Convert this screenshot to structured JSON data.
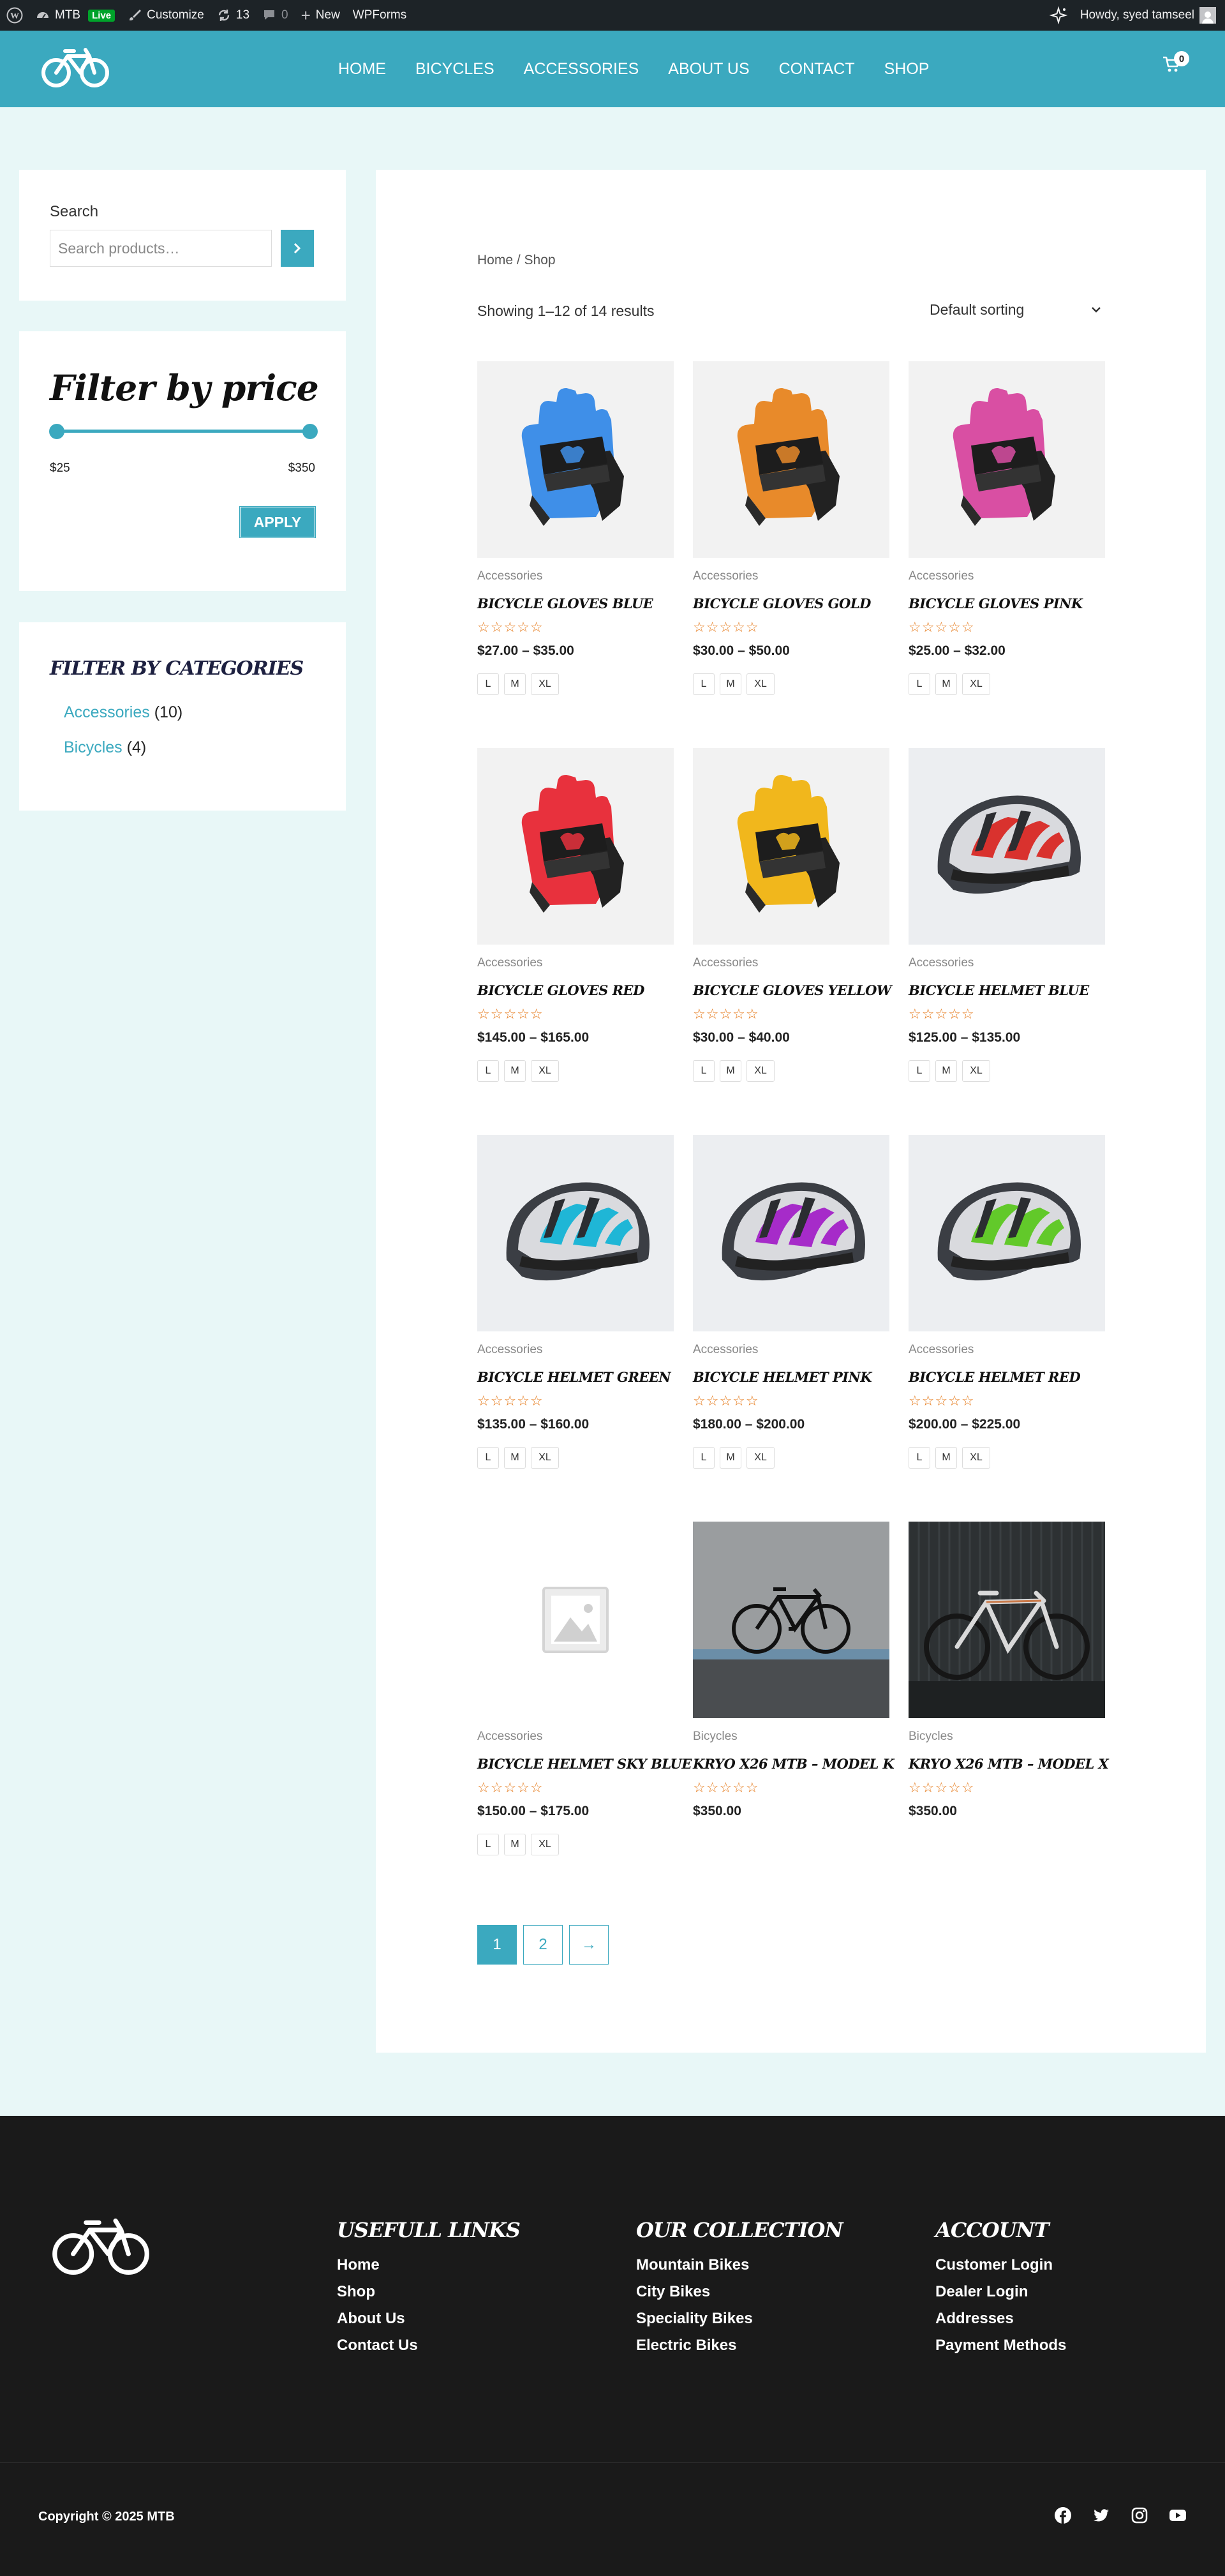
{
  "admin_bar": {
    "site_name": "MTB",
    "live_badge": "Live",
    "customize": "Customize",
    "updates_count": "13",
    "comments_count": "0",
    "new_label": "New",
    "wpforms": "WPForms",
    "howdy": "Howdy, syed tamseel"
  },
  "header": {
    "nav": [
      "HOME",
      "BICYCLES",
      "ACCESSORIES",
      "ABOUT US",
      "CONTACT",
      "SHOP"
    ],
    "cart_count": "0"
  },
  "sidebar": {
    "search_label": "Search",
    "search_placeholder": "Search products…",
    "price_title": "Filter by price",
    "price_min": "$25",
    "price_max": "$350",
    "apply_label": "APPLY",
    "categories_title": "FILTER BY CATEGORIES",
    "categories": [
      {
        "name": "Accessories",
        "count": "(10)"
      },
      {
        "name": "Bicycles",
        "count": "(4)"
      }
    ]
  },
  "shop": {
    "breadcrumb": "Home / Shop",
    "result_count": "Showing 1–12 of 14 results",
    "sort_label": "Default sorting",
    "products": [
      {
        "category": "Accessories",
        "name": "BICYCLE GLOVES BLUE",
        "price": "$27.00 – $35.00",
        "sizes": [
          "L",
          "M",
          "XL"
        ],
        "image": "glove",
        "color": "#3f8fe8"
      },
      {
        "category": "Accessories",
        "name": "BICYCLE GLOVES GOLD",
        "price": "$30.00 – $50.00",
        "sizes": [
          "L",
          "M",
          "XL"
        ],
        "image": "glove",
        "color": "#e88a2a"
      },
      {
        "category": "Accessories",
        "name": "BICYCLE GLOVES PINK",
        "price": "$25.00 – $32.00",
        "sizes": [
          "L",
          "M",
          "XL"
        ],
        "image": "glove",
        "color": "#d94fa3"
      },
      {
        "category": "Accessories",
        "name": "BICYCLE GLOVES RED",
        "price": "$145.00 – $165.00",
        "sizes": [
          "L",
          "M",
          "XL"
        ],
        "image": "glove",
        "color": "#e8313d"
      },
      {
        "category": "Accessories",
        "name": "BICYCLE GLOVES YELLOW",
        "price": "$30.00 – $40.00",
        "sizes": [
          "L",
          "M",
          "XL"
        ],
        "image": "glove",
        "color": "#f1b71c"
      },
      {
        "category": "Accessories",
        "name": "BICYCLE HELMET BLUE",
        "price": "$125.00 – $135.00",
        "sizes": [
          "L",
          "M",
          "XL"
        ],
        "image": "helmet",
        "color": "#d9322e"
      },
      {
        "category": "Accessories",
        "name": "BICYCLE HELMET GREEN",
        "price": "$135.00 – $160.00",
        "sizes": [
          "L",
          "M",
          "XL"
        ],
        "image": "helmet",
        "color": "#1fb6d6"
      },
      {
        "category": "Accessories",
        "name": "BICYCLE HELMET PINK",
        "price": "$180.00 – $200.00",
        "sizes": [
          "L",
          "M",
          "XL"
        ],
        "image": "helmet",
        "color": "#a62bc9"
      },
      {
        "category": "Accessories",
        "name": "BICYCLE HELMET RED",
        "price": "$200.00 – $225.00",
        "sizes": [
          "L",
          "M",
          "XL"
        ],
        "image": "helmet",
        "color": "#62c92a"
      },
      {
        "category": "Accessories",
        "name": "BICYCLE HELMET SKY BLUE",
        "price": "$150.00 – $175.00",
        "sizes": [
          "L",
          "M",
          "XL"
        ],
        "image": "placeholder",
        "color": "#cccccc"
      },
      {
        "category": "Bicycles",
        "name": "KRYO X26 MTB – MODEL K",
        "price": "$350.00",
        "sizes": [],
        "image": "bike-wall",
        "color": "#222222"
      },
      {
        "category": "Bicycles",
        "name": "KRYO X26 MTB – MODEL X",
        "price": "$350.00",
        "sizes": [],
        "image": "bike-dark",
        "color": "#dddddd"
      }
    ],
    "pagination": [
      "1",
      "2",
      "→"
    ]
  },
  "footer": {
    "columns": [
      {
        "title": "USEFULL LINKS",
        "links": [
          "Home",
          "Shop",
          "About Us",
          "Contact Us"
        ]
      },
      {
        "title": "OUR COLLECTION",
        "links": [
          "Mountain Bikes",
          "City Bikes",
          "Speciality Bikes",
          "Electric Bikes"
        ]
      },
      {
        "title": "ACCOUNT",
        "links": [
          "Customer Login",
          "Dealer Login",
          "Addresses",
          "Payment Methods"
        ]
      }
    ],
    "copyright": "Copyright © 2025 MTB",
    "social": [
      "facebook-icon",
      "twitter-icon",
      "instagram-icon",
      "youtube-icon"
    ]
  },
  "colors": {
    "accent": "#3ba9bf",
    "footer_bg": "#1a1a1a",
    "page_bg": "#e8f7f7",
    "star": "#e67e22"
  }
}
